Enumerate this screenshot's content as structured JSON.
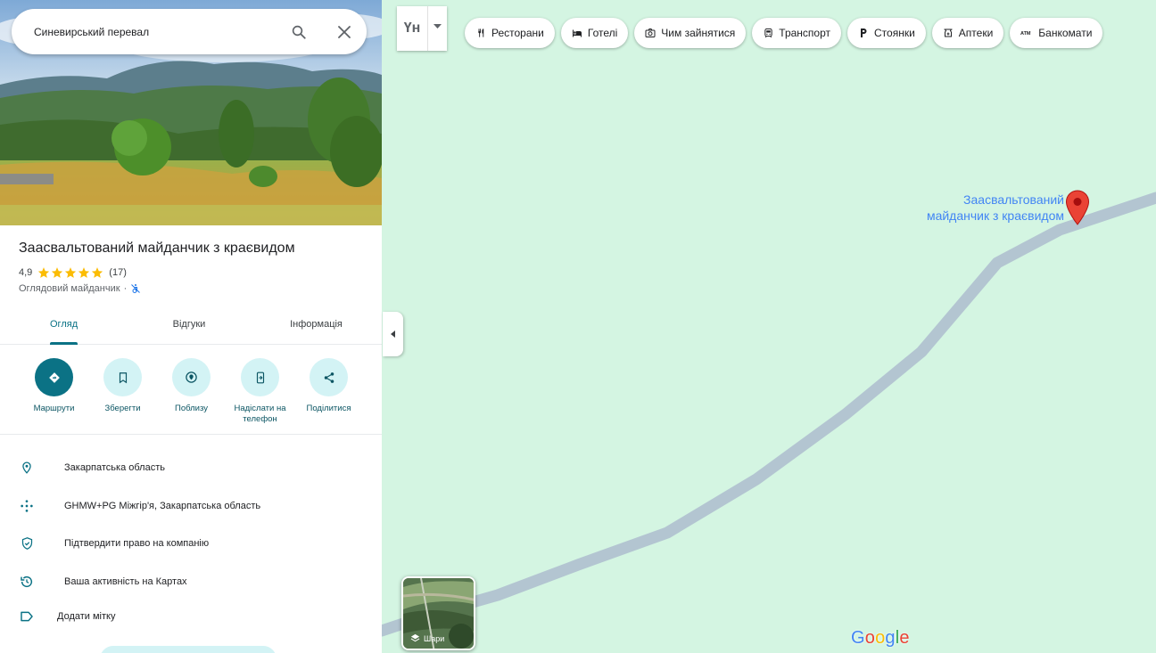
{
  "search": {
    "query": "Синевирський перевал",
    "placeholder": ""
  },
  "place": {
    "title": "Заасвальтований майданчик з краєвидом",
    "rating": "4,9",
    "reviews_count": "(17)",
    "stars_filled": 5,
    "type": "Оглядовий майданчик",
    "type_separator": "·"
  },
  "tabs": [
    {
      "label": "Огляд",
      "active": true
    },
    {
      "label": "Відгуки",
      "active": false
    },
    {
      "label": "Інформація",
      "active": false
    }
  ],
  "actions": [
    {
      "label": "Маршрути",
      "icon": "directions-icon"
    },
    {
      "label": "Зберегти",
      "icon": "bookmark-icon"
    },
    {
      "label": "Поблизу",
      "icon": "nearby-icon"
    },
    {
      "label": "Надіслати на телефон",
      "icon": "send-to-phone-icon"
    },
    {
      "label": "Поділитися",
      "icon": "share-icon"
    }
  ],
  "info": [
    {
      "text": "Закарпатська область",
      "icon": "location-pin-icon"
    },
    {
      "text": "GHMW+PG Міжгір'я, Закарпатська область",
      "icon": "plus-code-icon"
    },
    {
      "text": "Підтвердити право на компанію",
      "icon": "verified-shield-icon"
    },
    {
      "text": "Ваша активність на Картах",
      "icon": "history-icon"
    },
    {
      "text": "Додати мітку",
      "icon": "label-icon"
    }
  ],
  "map": {
    "lang_label": "Үн",
    "chips": [
      {
        "label": "Ресторани",
        "icon": "restaurant-icon"
      },
      {
        "label": "Готелі",
        "icon": "hotel-icon"
      },
      {
        "label": "Чим зайнятися",
        "icon": "camera-icon"
      },
      {
        "label": "Транспорт",
        "icon": "transit-icon"
      },
      {
        "label": "Стоянки",
        "icon": "parking-icon"
      },
      {
        "label": "Аптеки",
        "icon": "pharmacy-icon"
      },
      {
        "label": "Банкомати",
        "icon": "atm-icon"
      }
    ],
    "pin_label_line1": "Заасвальтований",
    "pin_label_line2": "майданчик з краєвидом",
    "layers_label": "Шари",
    "logo": "Google",
    "colors": {
      "map_bg": "#d4f5e2",
      "road": "#b3c5d1",
      "pin": "#ea4335",
      "accent": "#0b7285"
    }
  }
}
